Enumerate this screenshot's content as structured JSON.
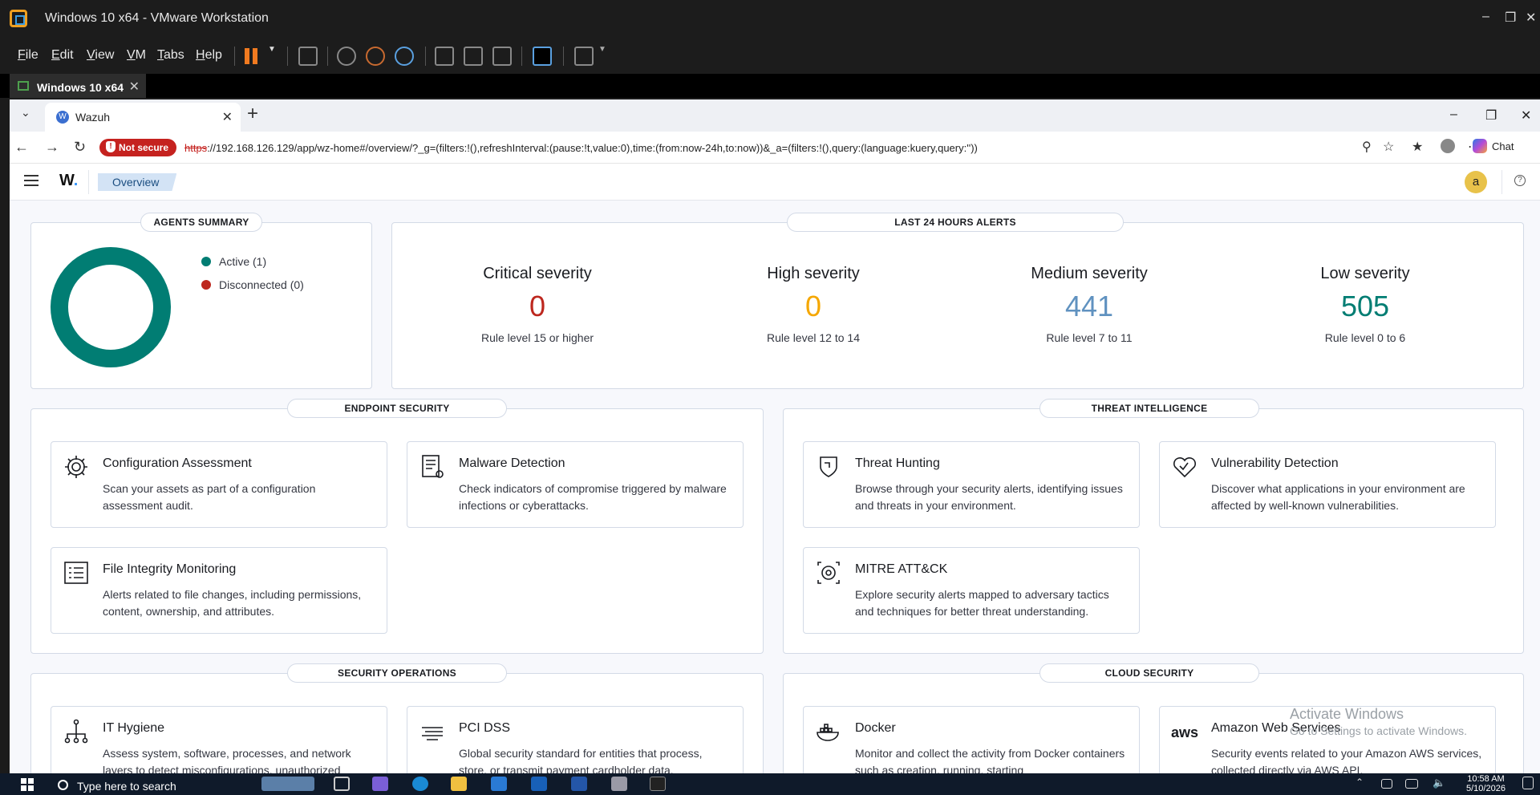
{
  "vmware": {
    "title": "Windows 10 x64 - VMware Workstation",
    "menu": [
      "File",
      "Edit",
      "View",
      "VM",
      "Tabs",
      "Help"
    ],
    "tab_label": "Windows 10 x64"
  },
  "browser": {
    "tab_title": "Wazuh",
    "not_secure": "Not secure",
    "url_scheme": "https",
    "url_rest": "://192.168.126.129/app/wz-home#/overview/?_g=(filters:!(),refreshInterval:(pause:!t,value:0),time:(from:now-24h,to:now))&_a=(filters:!(),query:(language:kuery,query:''))",
    "chat_label": "Chat"
  },
  "app": {
    "breadcrumb": "Overview",
    "avatar_letter": "a",
    "logo": "W"
  },
  "agents_summary": {
    "title": "AGENTS SUMMARY",
    "legend": [
      {
        "label": "Active (1)",
        "color": "#017d73"
      },
      {
        "label": "Disconnected (0)",
        "color": "#bd271e"
      }
    ]
  },
  "alerts": {
    "title": "LAST 24 HOURS ALERTS",
    "items": [
      {
        "title": "Critical severity",
        "value": "0",
        "sub": "Rule level 15 or higher",
        "color": "#bd271e"
      },
      {
        "title": "High severity",
        "value": "0",
        "sub": "Rule level 12 to 14",
        "color": "#f5a700"
      },
      {
        "title": "Medium severity",
        "value": "441",
        "sub": "Rule level 7 to 11",
        "color": "#6092c0"
      },
      {
        "title": "Low severity",
        "value": "505",
        "sub": "Rule level 0 to 6",
        "color": "#017d73"
      }
    ]
  },
  "sections": {
    "endpoint": {
      "title": "ENDPOINT SECURITY",
      "cards": [
        {
          "title": "Configuration Assessment",
          "desc": "Scan your assets as part of a configuration assessment audit.",
          "icon": "gear-icon"
        },
        {
          "title": "Malware Detection",
          "desc": "Check indicators of compromise triggered by malware infections or cyberattacks.",
          "icon": "document-gear-icon"
        },
        {
          "title": "File Integrity Monitoring",
          "desc": "Alerts related to file changes, including permissions, content, ownership, and attributes.",
          "icon": "list-icon"
        }
      ]
    },
    "threat": {
      "title": "THREAT INTELLIGENCE",
      "cards": [
        {
          "title": "Threat Hunting",
          "desc": "Browse through your security alerts, identifying issues and threats in your environment.",
          "icon": "shield-icon"
        },
        {
          "title": "Vulnerability Detection",
          "desc": "Discover what applications in your environment are affected by well-known vulnerabilities.",
          "icon": "heart-icon"
        },
        {
          "title": "MITRE ATT&CK",
          "desc": "Explore security alerts mapped to adversary tactics and techniques for better threat understanding.",
          "icon": "target-icon"
        }
      ]
    },
    "secops": {
      "title": "SECURITY OPERATIONS",
      "cards": [
        {
          "title": "IT Hygiene",
          "desc": "Assess system, software, processes, and network layers to detect misconfigurations, unauthorized",
          "icon": "network-icon"
        },
        {
          "title": "PCI DSS",
          "desc": "Global security standard for entities that process, store, or transmit payment cardholder data.",
          "icon": "pci-icon"
        }
      ]
    },
    "cloud": {
      "title": "CLOUD SECURITY",
      "cards": [
        {
          "title": "Docker",
          "desc": "Monitor and collect the activity from Docker containers such as creation, running, starting",
          "icon": "docker-icon"
        },
        {
          "title": "Amazon Web Services",
          "desc": "Security events related to your Amazon AWS services, collected directly via AWS API.",
          "icon": "aws-icon"
        }
      ]
    }
  },
  "watermark": {
    "line1": "Activate Windows",
    "line2": "Go to Settings to activate Windows."
  },
  "taskbar": {
    "search_placeholder": "Type here to search",
    "time": "10:58 AM",
    "date": "5/10/2026"
  }
}
